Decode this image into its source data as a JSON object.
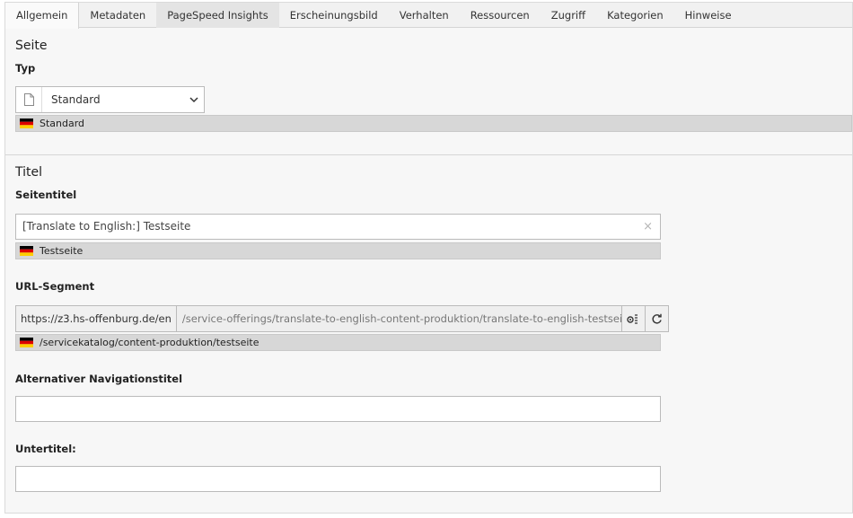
{
  "tabs": [
    "Allgemein",
    "Metadaten",
    "PageSpeed Insights",
    "Erscheinungsbild",
    "Verhalten",
    "Ressourcen",
    "Zugriff",
    "Kategorien",
    "Hinweise"
  ],
  "page_section": {
    "title": "Seite",
    "type_label": "Typ",
    "type_select": {
      "value": "Standard",
      "icon": "page-icon"
    },
    "type_reference": {
      "value": "Standard",
      "flag": "flag-de"
    }
  },
  "title_section": {
    "title": "Titel",
    "page_title_label": "Seitentitel",
    "page_title_value": "[Translate to English:] Testseite",
    "page_title_clear": "×",
    "page_title_reference": "Testseite",
    "url_label": "URL-Segment",
    "url_prefix": "https://z3.hs-offenburg.de/en",
    "url_value": "/service-offerings/translate-to-english-content-produktion/translate-to-english-testseite",
    "url_reference": "/servicekatalog/content-produktion/testseite",
    "nav_title_label": "Alternativer Navigationstitel",
    "nav_title_value": "",
    "subtitle_label": "Untertitel:",
    "subtitle_value": ""
  }
}
